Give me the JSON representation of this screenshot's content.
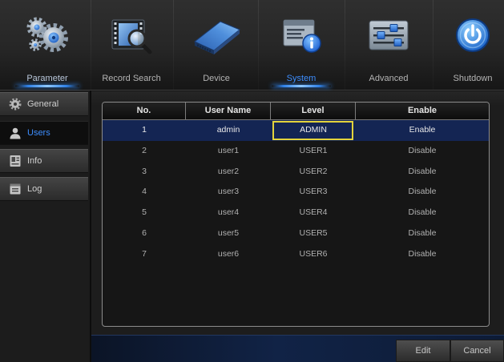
{
  "top_nav": {
    "items": [
      {
        "label": "Parameter",
        "icon": "gears-icon",
        "underline": true,
        "active": false
      },
      {
        "label": "Record Search",
        "icon": "film-search-icon",
        "underline": false,
        "active": false
      },
      {
        "label": "Device",
        "icon": "hard-drive-icon",
        "underline": false,
        "active": false
      },
      {
        "label": "System",
        "icon": "system-info-icon",
        "underline": true,
        "active": true
      },
      {
        "label": "Advanced",
        "icon": "sliders-icon",
        "underline": false,
        "active": false
      },
      {
        "label": "Shutdown",
        "icon": "power-icon",
        "underline": false,
        "active": false
      }
    ]
  },
  "sidebar": {
    "items": [
      {
        "label": "General",
        "icon": "gear-icon",
        "selected": false
      },
      {
        "label": "Users",
        "icon": "user-icon",
        "selected": true
      },
      {
        "label": "Info",
        "icon": "info-card-icon",
        "selected": false
      },
      {
        "label": "Log",
        "icon": "log-icon",
        "selected": false
      }
    ]
  },
  "users_table": {
    "columns": [
      "No.",
      "User Name",
      "Level",
      "Enable"
    ],
    "rows": [
      {
        "no": "1",
        "user_name": "admin",
        "level": "ADMIN",
        "enable": "Enable",
        "selected": true,
        "level_focused": true
      },
      {
        "no": "2",
        "user_name": "user1",
        "level": "USER1",
        "enable": "Disable",
        "selected": false,
        "level_focused": false
      },
      {
        "no": "3",
        "user_name": "user2",
        "level": "USER2",
        "enable": "Disable",
        "selected": false,
        "level_focused": false
      },
      {
        "no": "4",
        "user_name": "user3",
        "level": "USER3",
        "enable": "Disable",
        "selected": false,
        "level_focused": false
      },
      {
        "no": "5",
        "user_name": "user4",
        "level": "USER4",
        "enable": "Disable",
        "selected": false,
        "level_focused": false
      },
      {
        "no": "6",
        "user_name": "user5",
        "level": "USER5",
        "enable": "Disable",
        "selected": false,
        "level_focused": false
      },
      {
        "no": "7",
        "user_name": "user6",
        "level": "USER6",
        "enable": "Disable",
        "selected": false,
        "level_focused": false
      }
    ]
  },
  "footer": {
    "edit_label": "Edit",
    "cancel_label": "Cancel"
  },
  "colors": {
    "accent": "#3d8eff",
    "selected_row": "#142553",
    "focus_border": "#e3d33c",
    "underline_glow": "#2f80e6"
  }
}
